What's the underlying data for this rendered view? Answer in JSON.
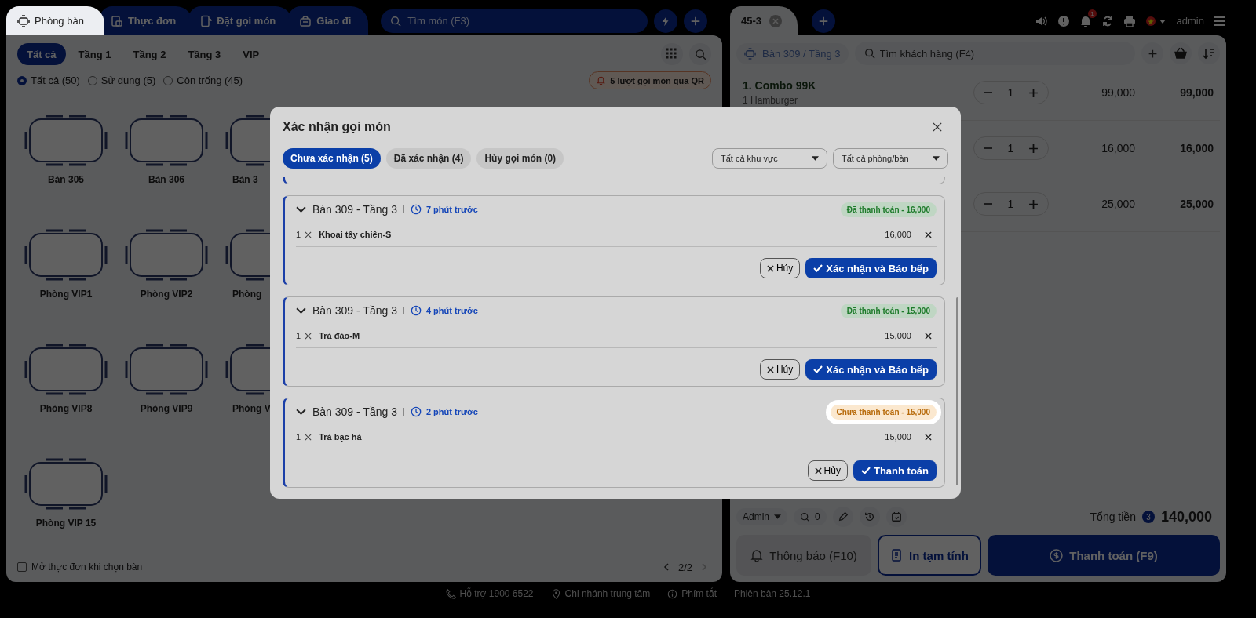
{
  "top_tabs": [
    {
      "label": "Phòng bàn",
      "selected": true
    },
    {
      "label": "Thực đơn",
      "selected": false
    },
    {
      "label": "Đặt gọi món",
      "selected": false
    },
    {
      "label": "Giao đi",
      "selected": false
    }
  ],
  "menu_search": {
    "placeholder": "Tìm món (F3)"
  },
  "floors": [
    {
      "label": "Tất cả",
      "selected": true
    },
    {
      "label": "Tầng 1",
      "selected": false
    },
    {
      "label": "Tầng 2",
      "selected": false
    },
    {
      "label": "Tầng 3",
      "selected": false
    },
    {
      "label": "VIP",
      "selected": false
    }
  ],
  "status_filters": [
    {
      "label": "Tất cả (50)",
      "selected": true
    },
    {
      "label": "Sử dụng (5)",
      "selected": false
    },
    {
      "label": "Còn trống (45)",
      "selected": false
    }
  ],
  "qr_notice": "5 lượt gọi món qua QR",
  "tables": [
    "Bàn 305",
    "Bàn 306",
    "Bàn 3",
    "Phòng VIP1",
    "Phòng VIP2",
    "Phòng",
    "Phòng VIP8",
    "Phòng VIP9",
    "Phòng V",
    "Phòng VIP 15"
  ],
  "open_menu_option": {
    "label": "Mở thực đơn khi chọn bàn",
    "checked": false
  },
  "pagination": {
    "page": "2/2"
  },
  "order_tab": {
    "label": "45-3"
  },
  "notification_count": "1",
  "user": "admin",
  "order": {
    "table": "Bàn 309 / Tầng 3",
    "customer_search": {
      "placeholder": "Tìm khách hàng (F4)"
    },
    "lines": [
      {
        "name": "1. Combo 99K",
        "detail": "1 Hamburger",
        "qty": "1",
        "price": "99,000",
        "total": "99,000"
      },
      {
        "qty": "1",
        "price": "16,000",
        "total": "16,000"
      },
      {
        "qty": "1",
        "price": "25,000",
        "total": "25,000"
      }
    ]
  },
  "order_footer": {
    "staff": "Admin",
    "guest_count": "0",
    "total_label": "Tổng tiền",
    "item_count": "3",
    "total": "140,000",
    "buttons": [
      {
        "label": "Thông báo (F10)",
        "kind": "secondary"
      },
      {
        "label": "In tạm tính",
        "kind": "outline"
      },
      {
        "label": "Thanh toán (F9)",
        "kind": "primary"
      }
    ]
  },
  "status_bar": [
    "Hỗ trợ 1900 6522",
    "Chi nhánh trung tâm",
    "Phím tắt",
    "Phiên bản 25.12.1"
  ],
  "modal": {
    "title": "Xác nhận gọi món",
    "tabs": [
      {
        "label": "Chưa xác nhận (5)",
        "selected": true
      },
      {
        "label": "Đã xác nhận (4)",
        "selected": false
      },
      {
        "label": "Hủy gọi món (0)",
        "selected": false
      }
    ],
    "filters": [
      {
        "value": "Tất cả khu vực"
      },
      {
        "value": "Tất cả phòng/bàn"
      }
    ],
    "orders": [
      {
        "table": "Bàn 309 - Tầng 3",
        "time": "7 phút trước",
        "payment": {
          "label": "Đã thanh toán - 16,000",
          "paid": true
        },
        "items": [
          {
            "qty": "1",
            "name": "Khoai tây chiên-S",
            "price": "16,000"
          }
        ],
        "cancel": "Hủy",
        "confirm": "Xác nhận và Báo bếp"
      },
      {
        "table": "Bàn 309 - Tầng 3",
        "time": "4 phút trước",
        "payment": {
          "label": "Đã thanh toán - 15,000",
          "paid": true
        },
        "items": [
          {
            "qty": "1",
            "name": "Trà đào-M",
            "price": "15,000"
          }
        ],
        "cancel": "Hủy",
        "confirm": "Xác nhận và Báo bếp"
      },
      {
        "table": "Bàn 309 - Tầng 3",
        "time": "2 phút trước",
        "payment": {
          "label": "Chưa thanh toán - 15,000",
          "paid": false
        },
        "items": [
          {
            "qty": "1",
            "name": "Trà bạc hà",
            "price": "15,000"
          }
        ],
        "cancel": "Hủy",
        "confirm": "Thanh toán"
      }
    ]
  }
}
